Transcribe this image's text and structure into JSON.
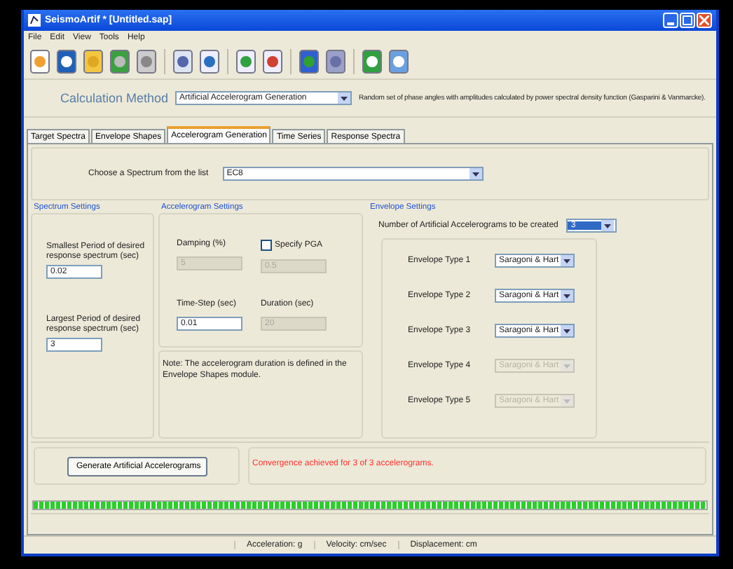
{
  "window": {
    "title": "SeismoArtif * [Untitled.sap]"
  },
  "menu": [
    "File",
    "Edit",
    "View",
    "Tools",
    "Help"
  ],
  "calculation_method": {
    "label": "Calculation Method",
    "value": "Artificial Accelerogram Generation",
    "description": "Random set of phase angles with amplitudes calculated by power spectral density function (Gasparini & Vanmarcke)."
  },
  "tabs": [
    {
      "label": "Target Spectra",
      "selected": false
    },
    {
      "label": "Envelope Shapes",
      "selected": false
    },
    {
      "label": "Accelerogram Generation",
      "selected": true
    },
    {
      "label": "Time Series",
      "selected": false
    },
    {
      "label": "Response Spectra",
      "selected": false
    }
  ],
  "spectrum_choice": {
    "label": "Choose a Spectrum from the list",
    "value": "EC8"
  },
  "spectrum_settings": {
    "title": "Spectrum Settings",
    "smallest_label": "Smallest Period of desired response spectrum (sec)",
    "smallest_value": "0.02",
    "largest_label": "Largest Period of desired response spectrum (sec)",
    "largest_value": "3"
  },
  "accelerogram_settings": {
    "title": "Accelerogram Settings",
    "damping_label": "Damping (%)",
    "damping_value": "5",
    "damping_disabled": true,
    "specify_pga": {
      "label": "Specify PGA",
      "checked": false
    },
    "pga_value": "0.5",
    "time_step_label": "Time-Step (sec)",
    "time_step_value": "0.01",
    "duration_label": "Duration (sec)",
    "duration_value": "20",
    "duration_disabled": true,
    "note": "Note: The accelerogram duration is defined in the Envelope Shapes module."
  },
  "envelope_settings": {
    "title": "Envelope Settings",
    "count_label": "Number of Artificial Accelerograms to be created",
    "count_value": "3",
    "types": [
      {
        "label": "Envelope Type 1",
        "value": "Saragoni & Hart",
        "disabled": false
      },
      {
        "label": "Envelope Type 2",
        "value": "Saragoni & Hart",
        "disabled": false
      },
      {
        "label": "Envelope Type 3",
        "value": "Saragoni & Hart",
        "disabled": false
      },
      {
        "label": "Envelope Type 4",
        "value": "Saragoni & Hart",
        "disabled": true
      },
      {
        "label": "Envelope Type 5",
        "value": "Saragoni & Hart",
        "disabled": true
      }
    ]
  },
  "generate_button": "Generate Artificial Accelerograms",
  "convergence_message": "Convergence achieved for 3 of 3 accelerograms.",
  "progress": {
    "level": 1
  },
  "status_bar": [
    "Acceleration: g",
    "Velocity: cm/sec",
    "Displacement: cm"
  ]
}
